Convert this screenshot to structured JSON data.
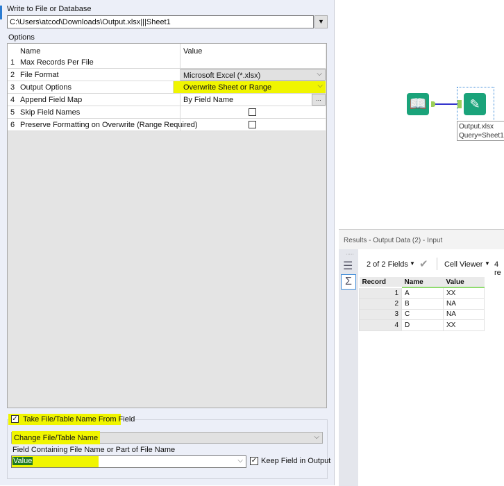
{
  "config": {
    "write_label": "Write to File or Database",
    "path_value": "C:\\Users\\atcod\\Downloads\\Output.xlsx|||Sheet1",
    "options_label": "Options",
    "grid_headers": {
      "name": "Name",
      "value": "Value"
    },
    "rows": [
      {
        "num": "1",
        "name": "Max Records Per File",
        "value": ""
      },
      {
        "num": "2",
        "name": "File Format",
        "value": "Microsoft Excel (*.xlsx)"
      },
      {
        "num": "3",
        "name": "Output Options",
        "value": "Overwrite Sheet or Range"
      },
      {
        "num": "4",
        "name": "Append Field Map",
        "value": "By Field Name",
        "button": "..."
      },
      {
        "num": "5",
        "name": "Skip Field Names",
        "checked": false
      },
      {
        "num": "6",
        "name": "Preserve Formatting on Overwrite (Range Required)",
        "checked": false
      }
    ],
    "take_name_label": "Take File/Table Name From Field",
    "take_name_checked": true,
    "change_mode": "Change File/Table Name",
    "field_label": "Field Containing File Name or Part of File Name",
    "field_value": "Value",
    "keep_field_label": "Keep Field in Output",
    "keep_field_checked": true,
    "check_mark": "✓"
  },
  "canvas": {
    "tool_label_1": "Output.xlsx",
    "tool_label_2": "Query=Sheet1"
  },
  "results": {
    "title": "Results - Output Data (2) - Input",
    "fields": "2 of 2 Fields",
    "viewer": "Cell Viewer",
    "records_partial": "4 re",
    "columns": [
      "Record",
      "Name",
      "Value"
    ],
    "rows": [
      [
        "1",
        "A",
        "XX"
      ],
      [
        "2",
        "B",
        "NA"
      ],
      [
        "3",
        "C",
        "NA"
      ],
      [
        "4",
        "D",
        "XX"
      ]
    ]
  },
  "colors": {
    "highlight": "#f0f500",
    "tool_green": "#1aa37a",
    "connector": "#3333cc"
  }
}
